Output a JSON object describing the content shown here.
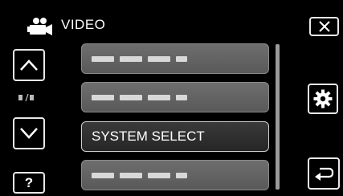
{
  "header": {
    "title": "VIDEO",
    "mode_icon": "video-camera-icon"
  },
  "nav": {
    "up_icon": "chevron-up-icon",
    "down_icon": "chevron-down-icon",
    "help_label": "?"
  },
  "menu": {
    "items": [
      {
        "label": "",
        "obscured": true
      },
      {
        "label": "",
        "obscured": true
      },
      {
        "label": "SYSTEM SELECT",
        "selected": true
      },
      {
        "label": "",
        "obscured": true
      }
    ]
  },
  "right_controls": {
    "close_icon": "close-icon",
    "settings_icon": "gear-icon",
    "back_icon": "return-arrow-icon"
  },
  "colors": {
    "background": "#000000",
    "row_fill": "#646464",
    "selected_row_fill": "#303030",
    "text": "#ffffff"
  }
}
